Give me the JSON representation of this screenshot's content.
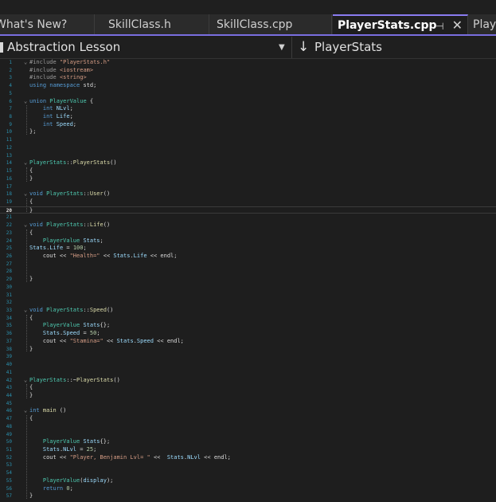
{
  "tabs": [
    {
      "label": "What's New?",
      "active": false
    },
    {
      "label": "SkillClass.h",
      "active": false
    },
    {
      "label": "SkillClass.cpp",
      "active": false
    },
    {
      "label": "PlayerStats.cpp",
      "active": true
    },
    {
      "label": "Playe",
      "active": false
    }
  ],
  "navbar": {
    "scope": "Abstraction Lesson",
    "member": "PlayerStats"
  },
  "editor": {
    "current_line": 20,
    "lines": [
      {
        "n": "1",
        "fold": "v",
        "t": [
          [
            "pp",
            "#include "
          ],
          [
            "str",
            "\"PlayerStats.h\""
          ]
        ]
      },
      {
        "n": "2",
        "fold": "",
        "t": [
          [
            "pp",
            "#include "
          ],
          [
            "str",
            "<iostream>"
          ]
        ]
      },
      {
        "n": "3",
        "fold": "",
        "t": [
          [
            "pp",
            "#include "
          ],
          [
            "str",
            "<string>"
          ]
        ]
      },
      {
        "n": "4",
        "fold": "",
        "t": [
          [
            "kw",
            "using namespace "
          ],
          [
            "pl",
            "std;"
          ]
        ]
      },
      {
        "n": "5",
        "fold": "",
        "t": []
      },
      {
        "n": "6",
        "fold": "v",
        "t": [
          [
            "kw",
            "union "
          ],
          [
            "cls",
            "PlayerValue"
          ],
          [
            "pl",
            " {"
          ]
        ]
      },
      {
        "n": "7",
        "fold": "",
        "t": [
          [
            "pl",
            "    "
          ],
          [
            "kw",
            "int "
          ],
          [
            "id",
            "NLvl"
          ],
          [
            "pl",
            ";"
          ]
        ]
      },
      {
        "n": "8",
        "fold": "",
        "t": [
          [
            "pl",
            "    "
          ],
          [
            "kw",
            "int "
          ],
          [
            "id",
            "Life"
          ],
          [
            "pl",
            ";"
          ]
        ]
      },
      {
        "n": "9",
        "fold": "",
        "t": [
          [
            "pl",
            "    "
          ],
          [
            "kw",
            "int "
          ],
          [
            "id",
            "Speed"
          ],
          [
            "pl",
            ";"
          ]
        ]
      },
      {
        "n": "10",
        "fold": "",
        "t": [
          [
            "pl",
            "};"
          ]
        ]
      },
      {
        "n": "11",
        "fold": "",
        "t": []
      },
      {
        "n": "12",
        "fold": "",
        "t": []
      },
      {
        "n": "13",
        "fold": "",
        "t": []
      },
      {
        "n": "14",
        "fold": "v",
        "t": [
          [
            "cls",
            "PlayerStats"
          ],
          [
            "pl",
            "::"
          ],
          [
            "fn",
            "PlayerStats"
          ],
          [
            "pl",
            "()"
          ]
        ]
      },
      {
        "n": "15",
        "fold": "",
        "t": [
          [
            "pl",
            "{"
          ]
        ]
      },
      {
        "n": "16",
        "fold": "",
        "t": [
          [
            "pl",
            "}"
          ]
        ]
      },
      {
        "n": "17",
        "fold": "",
        "t": []
      },
      {
        "n": "18",
        "fold": "v",
        "t": [
          [
            "kw",
            "void "
          ],
          [
            "cls",
            "PlayerStats"
          ],
          [
            "pl",
            "::"
          ],
          [
            "fn",
            "User"
          ],
          [
            "pl",
            "()"
          ]
        ]
      },
      {
        "n": "19",
        "fold": "",
        "t": [
          [
            "pl",
            "{"
          ]
        ]
      },
      {
        "n": "20",
        "fold": "",
        "t": [
          [
            "pl",
            "}"
          ]
        ]
      },
      {
        "n": "21",
        "fold": "",
        "t": []
      },
      {
        "n": "22",
        "fold": "v",
        "t": [
          [
            "kw",
            "void "
          ],
          [
            "cls",
            "PlayerStats"
          ],
          [
            "pl",
            "::"
          ],
          [
            "fn",
            "Life"
          ],
          [
            "pl",
            "()"
          ]
        ]
      },
      {
        "n": "23",
        "fold": "",
        "t": [
          [
            "pl",
            "{"
          ]
        ]
      },
      {
        "n": "24",
        "fold": "",
        "t": [
          [
            "pl",
            "    "
          ],
          [
            "cls",
            "PlayerValue "
          ],
          [
            "id",
            "Stats"
          ],
          [
            "pl",
            ";"
          ]
        ]
      },
      {
        "n": "25",
        "fold": "",
        "t": [
          [
            "id",
            "Stats"
          ],
          [
            "pl",
            "."
          ],
          [
            "id",
            "Life"
          ],
          [
            "pl",
            " = "
          ],
          [
            "num",
            "100"
          ],
          [
            "pl",
            ";"
          ]
        ]
      },
      {
        "n": "26",
        "fold": "",
        "t": [
          [
            "pl",
            "    cout << "
          ],
          [
            "str",
            "\"Health=\""
          ],
          [
            "pl",
            " << "
          ],
          [
            "id",
            "Stats"
          ],
          [
            "pl",
            "."
          ],
          [
            "id",
            "Life"
          ],
          [
            "pl",
            " << endl;"
          ]
        ]
      },
      {
        "n": "27",
        "fold": "",
        "t": []
      },
      {
        "n": "28",
        "fold": "",
        "t": []
      },
      {
        "n": "29",
        "fold": "",
        "t": [
          [
            "pl",
            "}"
          ]
        ]
      },
      {
        "n": "30",
        "fold": "",
        "t": []
      },
      {
        "n": "31",
        "fold": "",
        "t": []
      },
      {
        "n": "32",
        "fold": "",
        "t": []
      },
      {
        "n": "33",
        "fold": "v",
        "t": [
          [
            "kw",
            "void "
          ],
          [
            "cls",
            "PlayerStats"
          ],
          [
            "pl",
            "::"
          ],
          [
            "fn",
            "Speed"
          ],
          [
            "pl",
            "()"
          ]
        ]
      },
      {
        "n": "34",
        "fold": "",
        "t": [
          [
            "pl",
            "{"
          ]
        ]
      },
      {
        "n": "35",
        "fold": "",
        "t": [
          [
            "pl",
            "    "
          ],
          [
            "cls",
            "PlayerValue "
          ],
          [
            "id",
            "Stats"
          ],
          [
            "pl",
            "{};"
          ]
        ]
      },
      {
        "n": "36",
        "fold": "",
        "t": [
          [
            "pl",
            "    "
          ],
          [
            "id",
            "Stats"
          ],
          [
            "pl",
            "."
          ],
          [
            "id",
            "Speed"
          ],
          [
            "pl",
            " = "
          ],
          [
            "num",
            "50"
          ],
          [
            "pl",
            ";"
          ]
        ]
      },
      {
        "n": "37",
        "fold": "",
        "t": [
          [
            "pl",
            "    cout << "
          ],
          [
            "str",
            "\"Stamina=\""
          ],
          [
            "pl",
            " << "
          ],
          [
            "id",
            "Stats"
          ],
          [
            "pl",
            "."
          ],
          [
            "id",
            "Speed"
          ],
          [
            "pl",
            " << endl;"
          ]
        ]
      },
      {
        "n": "38",
        "fold": "",
        "t": [
          [
            "pl",
            "}"
          ]
        ]
      },
      {
        "n": "39",
        "fold": "",
        "t": []
      },
      {
        "n": "40",
        "fold": "",
        "t": []
      },
      {
        "n": "41",
        "fold": "",
        "t": []
      },
      {
        "n": "42",
        "fold": "v",
        "t": [
          [
            "cls",
            "PlayerStats"
          ],
          [
            "pl",
            "::~"
          ],
          [
            "fn",
            "PlayerStats"
          ],
          [
            "pl",
            "()"
          ]
        ]
      },
      {
        "n": "43",
        "fold": "",
        "t": [
          [
            "pl",
            "{"
          ]
        ]
      },
      {
        "n": "44",
        "fold": "",
        "t": [
          [
            "pl",
            "}"
          ]
        ]
      },
      {
        "n": "45",
        "fold": "",
        "t": []
      },
      {
        "n": "46",
        "fold": "v",
        "t": [
          [
            "kw",
            "int "
          ],
          [
            "fn",
            "main"
          ],
          [
            "pl",
            " ()"
          ]
        ]
      },
      {
        "n": "47",
        "fold": "",
        "t": [
          [
            "pl",
            "{"
          ]
        ]
      },
      {
        "n": "48",
        "fold": "",
        "t": []
      },
      {
        "n": "49",
        "fold": "",
        "t": []
      },
      {
        "n": "50",
        "fold": "",
        "t": [
          [
            "pl",
            "    "
          ],
          [
            "cls",
            "PlayerValue "
          ],
          [
            "id",
            "Stats"
          ],
          [
            "pl",
            "{};"
          ]
        ]
      },
      {
        "n": "51",
        "fold": "",
        "t": [
          [
            "pl",
            "    "
          ],
          [
            "id",
            "Stats"
          ],
          [
            "pl",
            "."
          ],
          [
            "id",
            "NLvl"
          ],
          [
            "pl",
            " = "
          ],
          [
            "num",
            "25"
          ],
          [
            "pl",
            ";"
          ]
        ]
      },
      {
        "n": "52",
        "fold": "",
        "t": [
          [
            "pl",
            "    cout << "
          ],
          [
            "str",
            "\"Player, Benjamin Lvl= \""
          ],
          [
            "pl",
            " <<  "
          ],
          [
            "id",
            "Stats"
          ],
          [
            "pl",
            "."
          ],
          [
            "id",
            "NLvl"
          ],
          [
            "pl",
            " << endl;"
          ]
        ]
      },
      {
        "n": "53",
        "fold": "",
        "t": []
      },
      {
        "n": "54",
        "fold": "",
        "t": []
      },
      {
        "n": "55",
        "fold": "",
        "t": [
          [
            "pl",
            "    "
          ],
          [
            "cls",
            "PlayerValue"
          ],
          [
            "pl",
            "("
          ],
          [
            "id",
            "display"
          ],
          [
            "pl",
            ");"
          ]
        ]
      },
      {
        "n": "56",
        "fold": "",
        "t": [
          [
            "pl",
            "    "
          ],
          [
            "kw",
            "return "
          ],
          [
            "num",
            "0"
          ],
          [
            "pl",
            ";"
          ]
        ]
      },
      {
        "n": "57",
        "fold": "",
        "t": [
          [
            "pl",
            "}"
          ]
        ]
      }
    ]
  }
}
